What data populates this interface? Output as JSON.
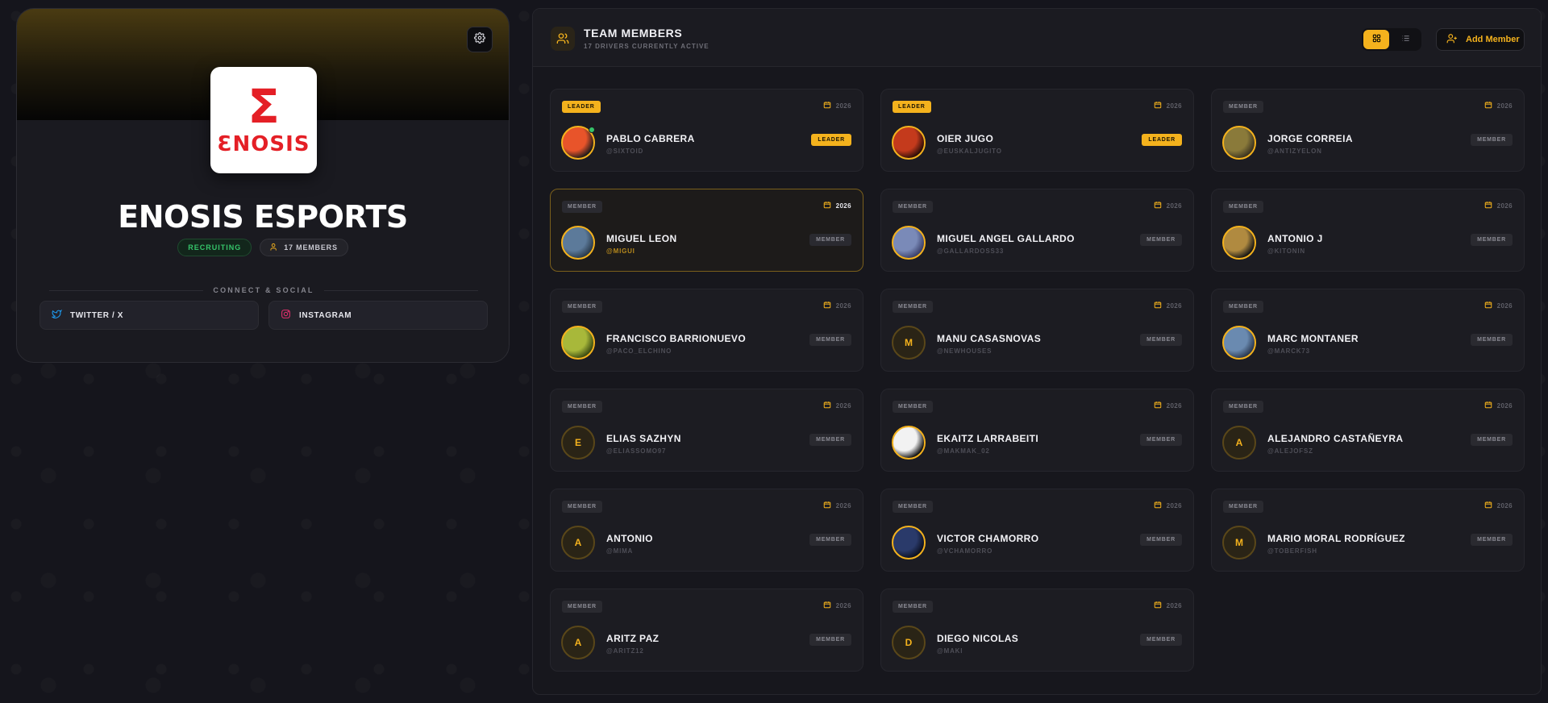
{
  "team": {
    "name": "ENOSIS ESPORTS",
    "logo_sigma": "Σ",
    "logo_word": "ƐNOSIS",
    "status_badge": "RECRUITING",
    "members_badge": "17 MEMBERS",
    "connect_label": "CONNECT & SOCIAL",
    "socials": [
      {
        "label": "TWITTER / X",
        "icon": "twitter-icon",
        "color": "#1d9bf0"
      },
      {
        "label": "INSTAGRAM",
        "icon": "instagram-icon",
        "color": "#e1306c"
      }
    ],
    "colors": {
      "accent": "#f4b21d",
      "recruiting": "#35c46a",
      "logo_red": "#e41f26"
    }
  },
  "panel": {
    "title": "TEAM MEMBERS",
    "subtitle": "17 DRIVERS CURRENTLY ACTIVE",
    "add_member_label": "Add Member",
    "view_modes": [
      "grid",
      "list"
    ],
    "active_view": "grid"
  },
  "members": [
    {
      "role_top": "LEADER",
      "year": "2026",
      "name": "PABLO CABRERA",
      "handle": "@SIXTOID",
      "role_tag": "LEADER",
      "avatar": "photo",
      "online": true
    },
    {
      "role_top": "LEADER",
      "year": "2026",
      "name": "OIER JUGO",
      "handle": "@EUSKALJUGITO",
      "role_tag": "LEADER",
      "avatar": "photo",
      "online": false
    },
    {
      "role_top": "MEMBER",
      "year": "2026",
      "name": "JORGE CORREIA",
      "handle": "@ANTIZYELON",
      "role_tag": "MEMBER",
      "avatar": "photo",
      "online": false
    },
    {
      "role_top": "MEMBER",
      "year": "2026",
      "name": "MIGUEL LEON",
      "handle": "@MIGUI",
      "role_tag": "MEMBER",
      "avatar": "photo",
      "online": false,
      "highlight": true
    },
    {
      "role_top": "MEMBER",
      "year": "2026",
      "name": "MIGUEL ANGEL GALLARDO",
      "handle": "@GALLARDOSS33",
      "role_tag": "MEMBER",
      "avatar": "photo",
      "online": false
    },
    {
      "role_top": "MEMBER",
      "year": "2026",
      "name": "ANTONIO J",
      "handle": "@KITONIN",
      "role_tag": "MEMBER",
      "avatar": "photo",
      "online": false
    },
    {
      "role_top": "MEMBER",
      "year": "2026",
      "name": "FRANCISCO BARRIONUEVO",
      "handle": "@PACO_ELCHINO",
      "role_tag": "MEMBER",
      "avatar": "photo",
      "online": false
    },
    {
      "role_top": "MEMBER",
      "year": "2026",
      "name": "MANU CASASNOVAS",
      "handle": "@NEWHOUSES",
      "role_tag": "MEMBER",
      "avatar": "initial",
      "initial": "M",
      "online": false
    },
    {
      "role_top": "MEMBER",
      "year": "2026",
      "name": "MARC MONTANER",
      "handle": "@MARCK73",
      "role_tag": "MEMBER",
      "avatar": "photo",
      "online": false
    },
    {
      "role_top": "MEMBER",
      "year": "2026",
      "name": "ELIAS SAZHYN",
      "handle": "@ELIASSOMO97",
      "role_tag": "MEMBER",
      "avatar": "initial",
      "initial": "E",
      "online": false
    },
    {
      "role_top": "MEMBER",
      "year": "2026",
      "name": "EKAITZ LARRABEITI",
      "handle": "@MAKMAK_02",
      "role_tag": "MEMBER",
      "avatar": "photo",
      "online": false
    },
    {
      "role_top": "MEMBER",
      "year": "2026",
      "name": "ALEJANDRO CASTAÑEYRA",
      "handle": "@ALEJOFSZ",
      "role_tag": "MEMBER",
      "avatar": "initial",
      "initial": "A",
      "online": false
    },
    {
      "role_top": "MEMBER",
      "year": "2026",
      "name": "ANTONIO",
      "handle": "@MIMA",
      "role_tag": "MEMBER",
      "avatar": "initial",
      "initial": "A",
      "online": false
    },
    {
      "role_top": "MEMBER",
      "year": "2026",
      "name": "VICTOR CHAMORRO",
      "handle": "@VCHAMORRO",
      "role_tag": "MEMBER",
      "avatar": "photo",
      "online": false
    },
    {
      "role_top": "MEMBER",
      "year": "2026",
      "name": "MARIO MORAL RODRÍGUEZ",
      "handle": "@TOBERFISH",
      "role_tag": "MEMBER",
      "avatar": "initial",
      "initial": "M",
      "online": false
    },
    {
      "role_top": "MEMBER",
      "year": "2026",
      "name": "ARITZ PAZ",
      "handle": "@ARITZ12",
      "role_tag": "MEMBER",
      "avatar": "initial",
      "initial": "A",
      "online": false
    },
    {
      "role_top": "MEMBER",
      "year": "2026",
      "name": "DIEGO NICOLAS",
      "handle": "@MAKI",
      "role_tag": "MEMBER",
      "avatar": "initial",
      "initial": "D",
      "online": false
    }
  ]
}
